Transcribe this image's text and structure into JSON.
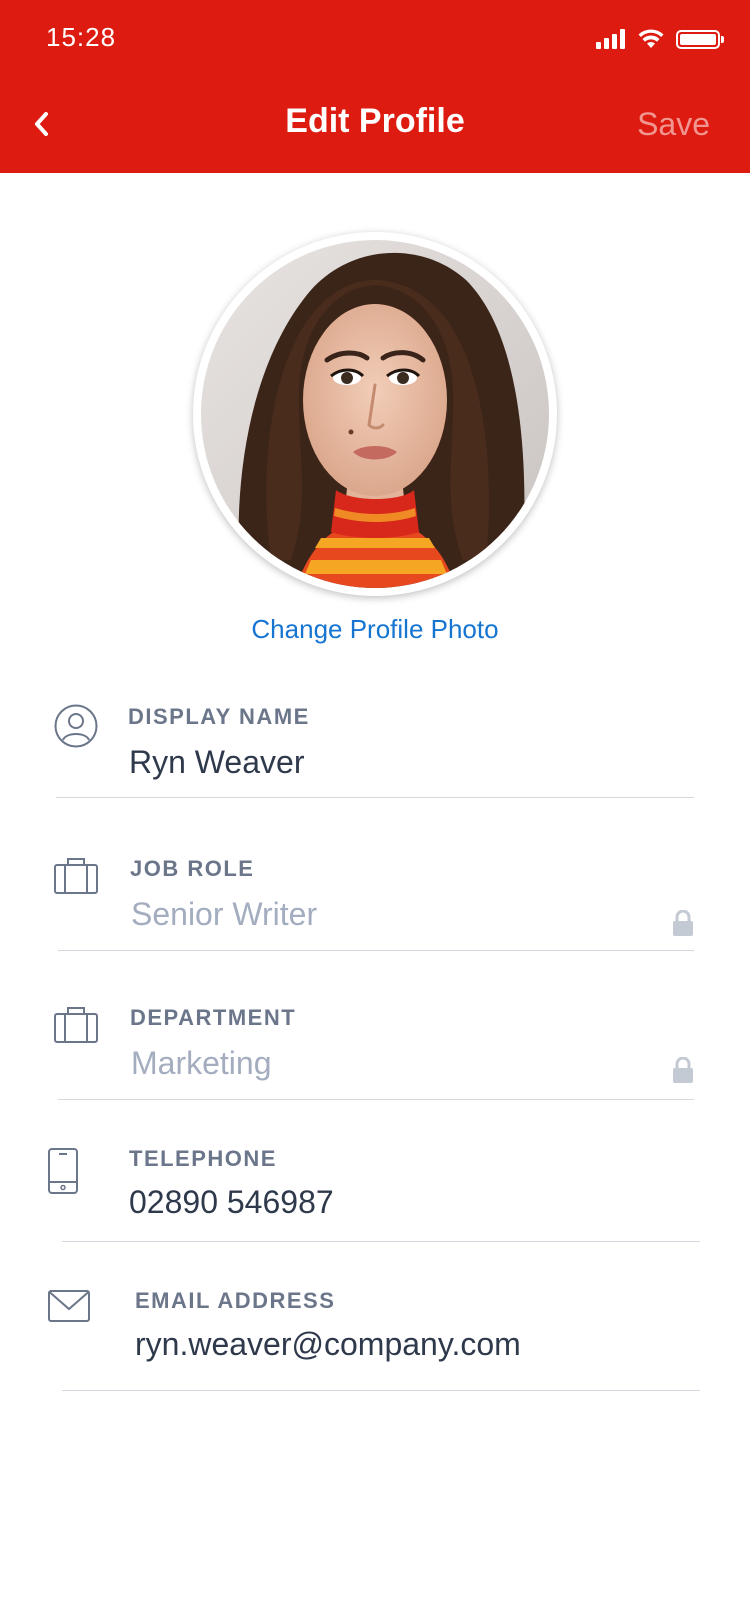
{
  "status_bar": {
    "time": "15:28"
  },
  "header": {
    "title": "Edit Profile",
    "save_label": "Save",
    "back_icon": "chevron-left-icon",
    "background_color": "#dd1b10"
  },
  "profile": {
    "change_photo_label": "Change Profile Photo",
    "link_color": "#1775d2"
  },
  "fields": {
    "display_name": {
      "label": "DISPLAY NAME",
      "value": "Ryn Weaver",
      "icon": "user-circle-icon",
      "locked": false
    },
    "job_role": {
      "label": "JOB ROLE",
      "value": "Senior Writer",
      "icon": "briefcase-icon",
      "locked": true
    },
    "department": {
      "label": "DEPARTMENT",
      "value": "Marketing",
      "icon": "briefcase-icon",
      "locked": true
    },
    "telephone": {
      "label": "TELEPHONE",
      "value": "02890 546987",
      "icon": "phone-icon",
      "locked": false
    },
    "email": {
      "label": "EMAIL ADDRESS",
      "value": "ryn.weaver@company.com",
      "icon": "envelope-icon",
      "locked": false
    }
  }
}
